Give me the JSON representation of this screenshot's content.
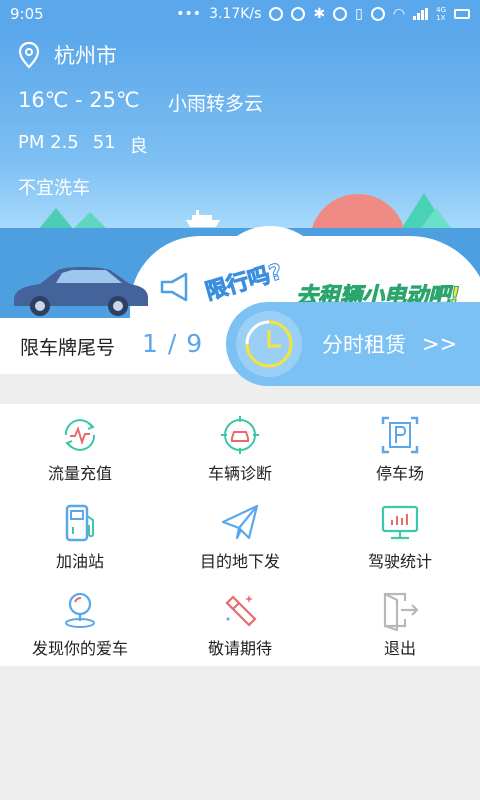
{
  "status_bar": {
    "time": "9:05",
    "network_speed": "3.17K/s",
    "network_type": "4G",
    "sim_slot": "1X"
  },
  "weather": {
    "city": "杭州市",
    "temperature": "16℃ - 25℃",
    "condition": "小雨转多云",
    "pm_label": "PM 2.5",
    "pm_value": "51",
    "pm_grade": "良",
    "car_wash": "不宜洗车"
  },
  "banner": {
    "question": "限行吗?",
    "promo": "去租辆小电动吧!"
  },
  "restriction": {
    "label": "限车牌尾号",
    "numbers": "1 / 9"
  },
  "rental": {
    "label": "分时租赁",
    "arrow": ">>"
  },
  "menu": [
    {
      "label": "流量充值",
      "icon": "data-recharge-icon"
    },
    {
      "label": "车辆诊断",
      "icon": "car-diagnosis-icon"
    },
    {
      "label": "停车场",
      "icon": "parking-icon"
    },
    {
      "label": "加油站",
      "icon": "gas-station-icon"
    },
    {
      "label": "目的地下发",
      "icon": "paper-plane-icon"
    },
    {
      "label": "驾驶统计",
      "icon": "driving-stats-icon"
    },
    {
      "label": "发现你的爱车",
      "icon": "find-car-icon"
    },
    {
      "label": "敬请期待",
      "icon": "coming-soon-icon"
    },
    {
      "label": "退出",
      "icon": "logout-icon"
    }
  ],
  "colors": {
    "brand_blue": "#5aa7ec",
    "teal": "#3ec6a8",
    "red": "#e86a6a",
    "gray": "#b8b8b8"
  }
}
